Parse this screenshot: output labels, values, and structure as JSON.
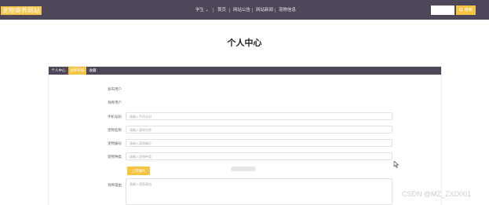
{
  "header": {
    "logo": "宠物寄养网站",
    "nav": [
      "学生 ⌄",
      "首页",
      "网站公告",
      "网站新闻",
      "宠物信息"
    ],
    "search_placeholder": "",
    "search_button": "搜索"
  },
  "page_title": "个人中心",
  "tabs": [
    "个人中心",
    "领养审核",
    "收藏"
  ],
  "form": {
    "publisher_label": "发布用户",
    "adopter_label": "领养用户",
    "phone_label": "手机号码",
    "phone_placeholder": "请输入手机号码",
    "pet_name_label": "宠物名称",
    "pet_name_placeholder": "请输入宠物名称",
    "pet_id_label": "宠物编号",
    "pet_id_placeholder": "请输入宠物编号",
    "pet_type_label": "宠物种类",
    "pet_type_placeholder": "请输入宠物种类",
    "upload_button": "上传图片",
    "reason_label": "领养理由",
    "reason_placeholder": "请输入领养理由"
  },
  "watermark": "CSDN @MZ_ZXD001",
  "colors": {
    "header_bg": "#4e4759",
    "accent": "#f6c443"
  }
}
